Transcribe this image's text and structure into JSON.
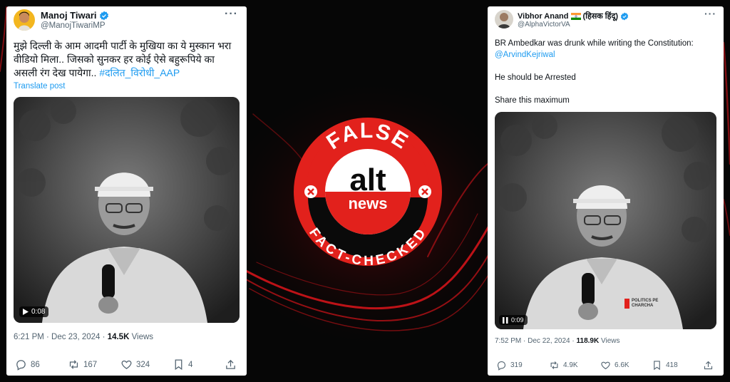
{
  "tweets": [
    {
      "name": "Manoj Tiwari",
      "handle": "@ManojTiwariMP",
      "text_lines": [
        "मुझे दिल्ली के आम आदमी पार्टी के मुखिया का ये मुस्कान भरा",
        "वीडियो मिला.. जिसको सुनकर हर कोई ऐसे बहुरूपिये का",
        "असली रंग देख पायेगा.."
      ],
      "hashtag": "#दलित_विरोधी_AAP",
      "translate": "Translate post",
      "video_time": "0:08",
      "time": "6:21 PM · Dec 23, 2024 · ",
      "views_count": "14.5K",
      "views_label": " Views",
      "replies": "86",
      "reposts": "167",
      "likes": "324",
      "bookmarks": "4"
    },
    {
      "name": "Vibhor Anand",
      "name_suffix": "(हिसक हिंदू)",
      "handle": "@AlphaVictorVA",
      "line1": "BR Ambedkar was drunk while writing the Constitution:",
      "mention": "@ArvindKejriwal",
      "line2": "He should be Arrested",
      "line3": "Share this maximum",
      "video_time": "0:09",
      "watermark_line1": "POLITICS PE",
      "watermark_line2": "CHARCHA",
      "time": "7:52 PM · Dec 22, 2024 · ",
      "views_count": "118.9K",
      "views_label": " Views",
      "replies": "319",
      "reposts": "4.9K",
      "likes": "6.6K",
      "bookmarks": "418"
    }
  ],
  "badge": {
    "top": "FALSE",
    "logo_top": "alt",
    "logo_bottom": "news",
    "bottom": "FACT-CHECKED"
  },
  "colors": {
    "badge_red": "#e2211c",
    "link_blue": "#1d9bf0",
    "background": "#060606",
    "swoosh_red": "#d0141a"
  }
}
